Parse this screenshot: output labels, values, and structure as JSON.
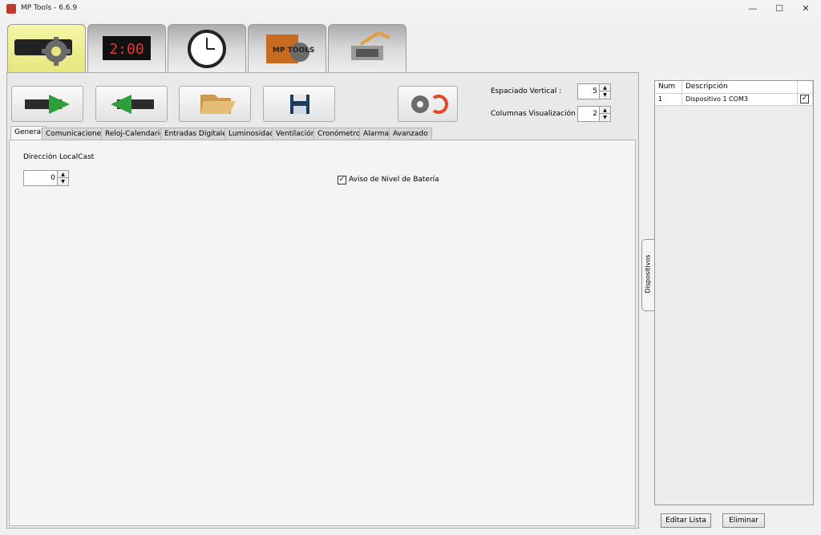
{
  "window": {
    "title": "MP Tools - 6.6.9",
    "controls": {
      "minimize": "—",
      "maximize": "☐",
      "close": "✕"
    }
  },
  "big_tabs": [
    {
      "name": "settings",
      "active": true
    },
    {
      "name": "led-display",
      "display_text": "2:00"
    },
    {
      "name": "clock"
    },
    {
      "name": "mp-tools-logo",
      "logo_text": "MP TOOLS"
    },
    {
      "name": "serial-cable"
    }
  ],
  "toolbar": {
    "spacing_vertical": {
      "label": "Espaciado Vertical :",
      "value": "5"
    },
    "columns": {
      "label": "Columnas Visualización :",
      "value": "2"
    },
    "spinner_up": "▲",
    "spinner_down": "▼"
  },
  "sub_tabs": [
    "General",
    "Comunicaciones",
    "Reloj-Calendario",
    "Entradas Digitales",
    "Luminosidad",
    "Ventilación",
    "Cronómetro",
    "Alarma",
    "Avanzado"
  ],
  "general": {
    "localcast_label": "Dirección LocalCast",
    "localcast_value": "0",
    "battery_label": "Aviso de Nivel de Batería",
    "battery_checked": "✓"
  },
  "side_tab": {
    "label": "Dispositivos"
  },
  "devices": {
    "headers": [
      "Num",
      "Descripción"
    ],
    "rows": [
      {
        "num": "1",
        "desc": "Dispositivo 1 COM3",
        "checked": "✓"
      }
    ],
    "edit_button": "Editar Lista",
    "delete_button": "Eliminar"
  },
  "colors": {
    "active_tab": "#f0f09a",
    "arrow_green": "#2e9e3a",
    "panel_bg": "#e9e9e9"
  }
}
